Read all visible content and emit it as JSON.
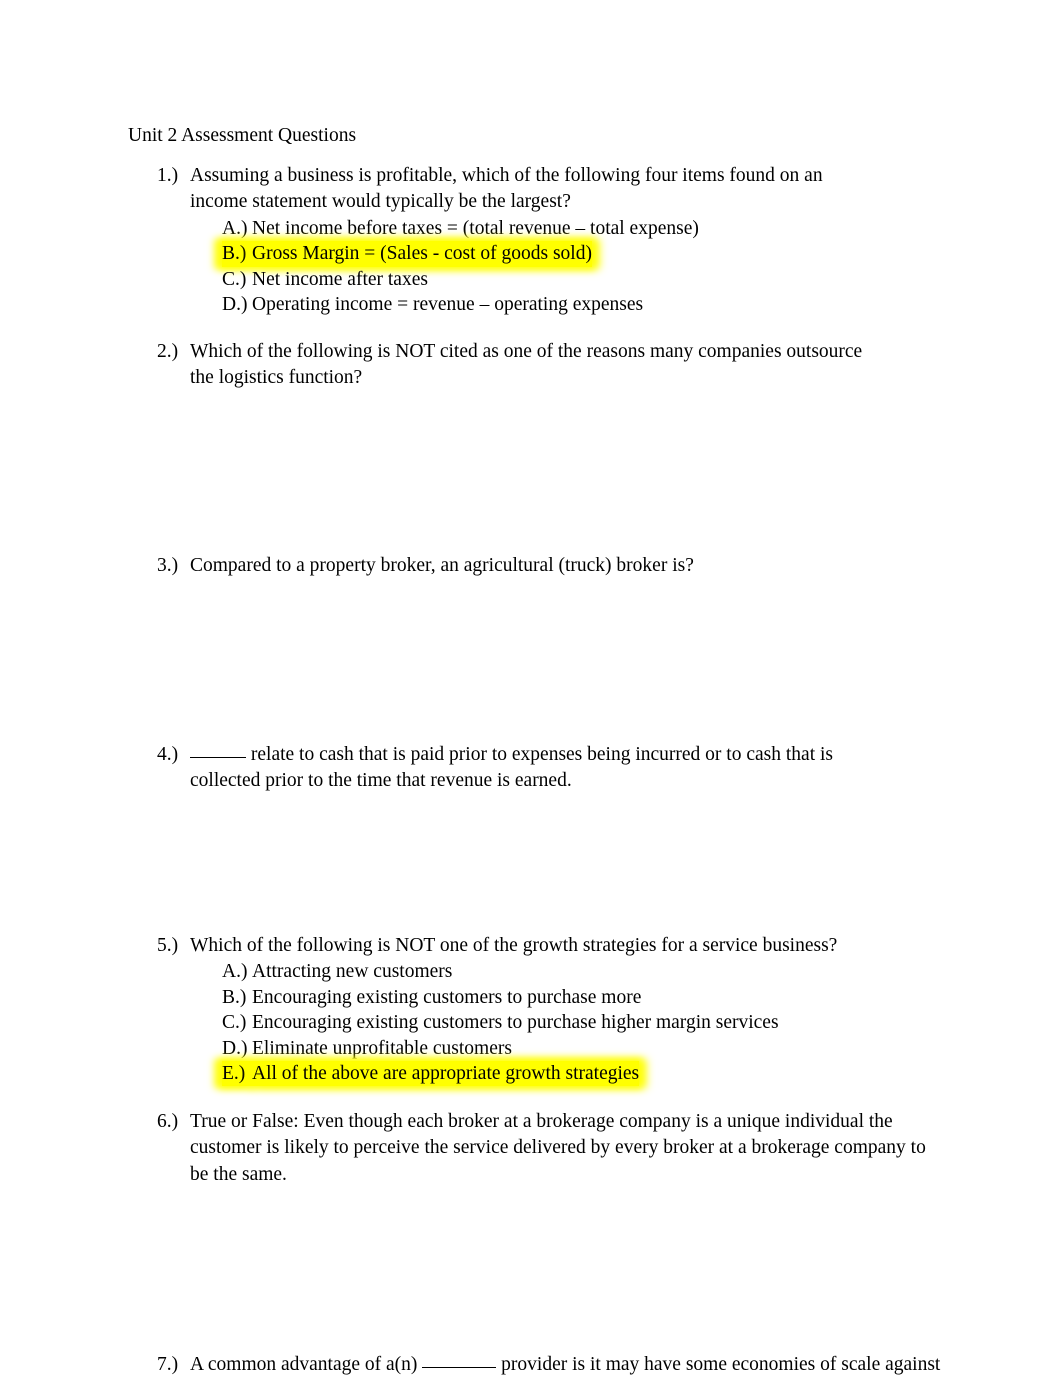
{
  "document": {
    "title": "Unit 2 Assessment Questions"
  },
  "questions": [
    {
      "number": "1.)",
      "stem": "Assuming a business is profitable, which of the following four items found on an income statement would typically be the largest?",
      "options": [
        {
          "letter": "A.)",
          "text": "Net income before taxes = (total revenue – total expense)",
          "highlighted": false
        },
        {
          "letter": "B.)",
          "text": "Gross Margin = (Sales - cost of goods sold)",
          "highlighted": true
        },
        {
          "letter": "C.)",
          "text": "Net income after taxes",
          "highlighted": false
        },
        {
          "letter": "D.)",
          "text": "Operating income = revenue – operating expenses",
          "highlighted": false
        }
      ]
    },
    {
      "number": "2.)",
      "stem": "Which of the following is NOT cited as one of the reasons many companies outsource the logistics function?",
      "options": []
    },
    {
      "number": "3.)",
      "stem": "Compared to a property broker, an agricultural (truck) broker is?",
      "options": []
    },
    {
      "number": "4.)",
      "stem_before_blank": "",
      "stem_after_blank": " relate to cash that is paid prior to expenses being incurred or to cash that is collected prior to the time that revenue is earned.",
      "options": []
    },
    {
      "number": "5.)",
      "stem": "Which of the following is NOT one of the growth strategies for a service business?",
      "options": [
        {
          "letter": "A.)",
          "text": "Attracting new customers",
          "highlighted": false
        },
        {
          "letter": "B.)",
          "text": "Encouraging existing customers to purchase more",
          "highlighted": false
        },
        {
          "letter": "C.)",
          "text": "Encouraging existing customers to purchase higher margin services",
          "highlighted": false
        },
        {
          "letter": "D.)",
          "text": "Eliminate unprofitable customers",
          "highlighted": false
        },
        {
          "letter": "E.)",
          "text": "All of the above are appropriate growth strategies",
          "highlighted": true
        }
      ]
    },
    {
      "number": "6.)",
      "stem": "True or False:  Even though each broker at a brokerage company is a unique individual the customer is likely to perceive the service delivered by every broker at a brokerage company to be the same.",
      "options": []
    },
    {
      "number": "7.)",
      "stem_before_blank": "A common advantage of a(n) ",
      "stem_after_blank": " provider is it may have some economies of scale against",
      "options": []
    }
  ]
}
